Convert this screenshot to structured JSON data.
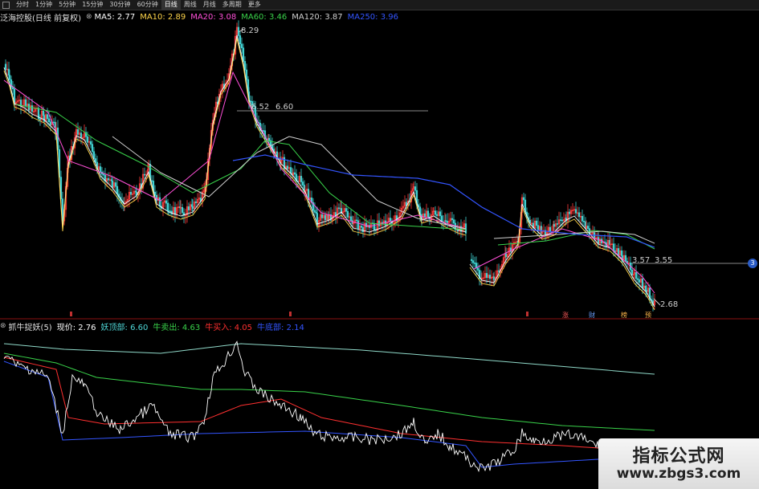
{
  "toolbar": {
    "items": [
      "分时",
      "1分钟",
      "5分钟",
      "15分钟",
      "30分钟",
      "60分钟",
      "日线",
      "周线",
      "月线",
      "多周期",
      "更多"
    ],
    "active_index": 6
  },
  "main_legend": {
    "stock": "泛海控股(日线 前复权)",
    "ma5": "MA5: 2.77",
    "ma10": "MA10: 2.89",
    "ma20": "MA20: 3.08",
    "ma60": "MA60: 3.46",
    "ma120": "MA120: 3.87",
    "ma250": "MA250: 3.96",
    "colors": {
      "ma5": "#ffffff",
      "ma10": "#ffd54a",
      "ma20": "#ff4fd8",
      "ma60": "#39d24a",
      "ma120": "#cfcfcf",
      "ma250": "#3355ff"
    }
  },
  "main_annotations": {
    "high": "8.29",
    "mid": "6.52",
    "mid2": "6.60",
    "low_label": "3.57",
    "low_label2": "3.55",
    "last": "2.68",
    "marker": "3"
  },
  "indicator_legend": {
    "name": "抓牛捉妖(5)",
    "price": "现价: 2.76",
    "top": "妖顶部: 6.60",
    "sell": "牛卖出: 4.63",
    "buy": "牛买入: 4.05",
    "bottom": "牛底部: 2.14",
    "colors": {
      "price": "#ffffff",
      "top": "#4fd8d8",
      "sell": "#39d24a",
      "buy": "#ff3030",
      "bottom": "#3355ff"
    }
  },
  "event_marks": [
    "涨",
    "财",
    "榜",
    "预"
  ],
  "watermark": {
    "title": "指标公式网",
    "url": "www.zbgs3.com"
  }
}
